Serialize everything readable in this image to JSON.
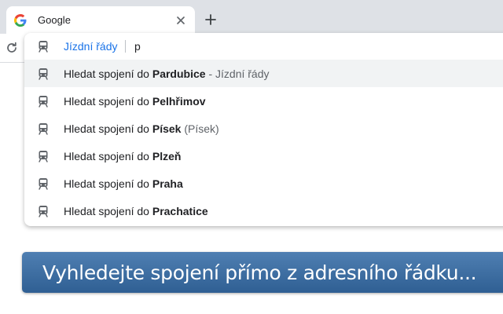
{
  "tab": {
    "title": "Google",
    "logo_letter": "G"
  },
  "omnibox": {
    "keyword": "Jízdní řády",
    "typed": "p"
  },
  "suggestions": [
    {
      "prefix": "Hledat spojení do ",
      "bold": "Pardubice",
      "separator": " - ",
      "description": "Jízdní řády",
      "selected": true
    },
    {
      "prefix": "Hledat spojení do ",
      "bold": "Pelhřimov"
    },
    {
      "prefix": "Hledat spojení do ",
      "bold": "Písek",
      "extra": " (Písek)"
    },
    {
      "prefix": "Hledat spojení do ",
      "bold": "Plzeň"
    },
    {
      "prefix": "Hledat spojení do ",
      "bold": "Praha"
    },
    {
      "prefix": "Hledat spojení do ",
      "bold": "Prachatice"
    }
  ],
  "banner": {
    "text": "Vyhledejte spojení přímo z adresního řádku..."
  },
  "colors": {
    "accent": "#1a73e8",
    "banner_top": "#4f7fb2",
    "banner_bottom": "#2f5f93",
    "tabstrip": "#dee1e6"
  },
  "icons": {
    "favicon": "google-g-icon",
    "close": "close-icon",
    "new_tab": "plus-icon",
    "reload": "reload-icon",
    "suggestion": "train-icon"
  }
}
